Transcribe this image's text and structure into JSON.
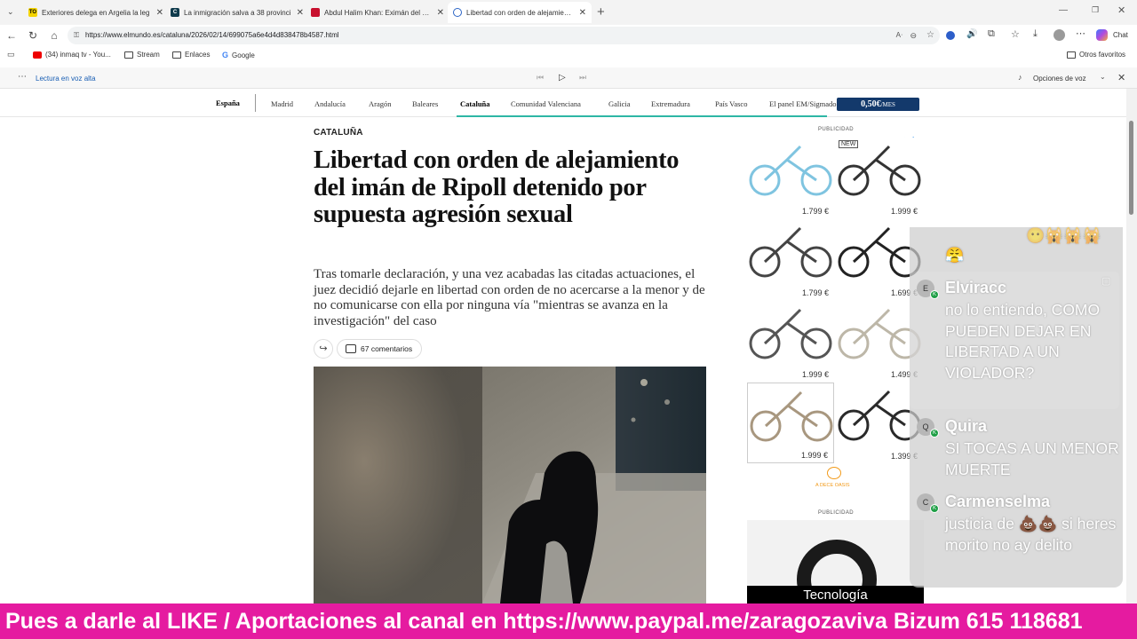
{
  "tabs": [
    {
      "title": "Exteriores delega en Argelia la leg",
      "favicon": "TO",
      "fav_bg": "#f4d400",
      "fav_fg": "#000"
    },
    {
      "title": "La inmigración salva a 38 provinci",
      "favicon": "C",
      "fav_bg": "#0f3b4c",
      "fav_fg": "#fff"
    },
    {
      "title": "Abdul Halim Khan: Eximán del est",
      "favicon": "",
      "fav_bg": "#c8102e",
      "fav_fg": "#fff"
    },
    {
      "title": "Libertad con orden de alejamiento",
      "favicon": "",
      "fav_bg": "#2b64c5",
      "fav_fg": "#fff",
      "active": true
    }
  ],
  "browser": {
    "url": "https://www.elmundo.es/cataluna/2026/02/14/699075a6e4d4d838478b4587.html",
    "chat_label": "Chat"
  },
  "bookmarks": [
    {
      "label": "(34) inmaq tv - You..."
    },
    {
      "label": "Stream"
    },
    {
      "label": "Enlaces"
    },
    {
      "label": "Google"
    }
  ],
  "other_favorites": "Otros favoritos",
  "read_aloud": {
    "label": "Lectura en voz alta",
    "options": "Opciones de voz"
  },
  "section_nav": {
    "items": [
      "España",
      "Madrid",
      "Andalucía",
      "Aragón",
      "Baleares",
      "Cataluña",
      "Comunidad Valenciana",
      "Galicia",
      "Extremadura",
      "País Vasco",
      "El panel EM/Sigmado"
    ],
    "subscribe_price": "0,50€",
    "subscribe_suffix": "/MES"
  },
  "article": {
    "kicker": "CATALUÑA",
    "headline": "Libertad con orden de alejamiento del imán de Ripoll detenido por supuesta agresión sexual",
    "lede": "Tras tomarle declaración, y una vez acabadas las citadas actuaciones, el juez decidió dejarle en libertad con orden de no acercarse a la menor y de no comunicarse con ella por ninguna vía \"mientras se avanza en la investigación\" del caso",
    "comments": "67 comentarios"
  },
  "ads": {
    "label": "PUBLICIDAD",
    "new_badge": "NEW",
    "bikes": [
      {
        "price": "1.799 €",
        "color": "#7fc4e0"
      },
      {
        "price": "1.999 €",
        "color": "#333333"
      },
      {
        "price": "1.799 €",
        "color": "#444444"
      },
      {
        "price": "1.699 €",
        "color": "#222222"
      },
      {
        "price": "1.999 €",
        "color": "#555555"
      },
      {
        "price": "1.499 €",
        "color": "#d8d3c6"
      },
      {
        "price": "1.999 €",
        "color": "#c8b9a4"
      },
      {
        "price": "1.399 €",
        "color": "#2a2a2a"
      }
    ],
    "brand": "A DECE OASIS",
    "label2": "PUBLICIDAD",
    "tech_band": "Tecnología"
  },
  "chat": {
    "messages": [
      {
        "user": "Elviracc",
        "avatar": "E",
        "text": "no lo entiendo, COMO PUEDEN DEJAR EN LIBERTAD A UN VIOLADOR?"
      },
      {
        "user": "Quira",
        "avatar": "Q",
        "text": "SI TOCAS A UN MENOR MUERTE"
      },
      {
        "user": "Carmenselma",
        "avatar": "C",
        "text": "justicia de 💩💩 si heres morito no ay delito"
      }
    ]
  },
  "banner": {
    "text": "Pues a darle al LIKE / Aportaciones al canal en https://www.paypal.me/zaragozaviva Bizum 615 118681"
  },
  "colors": {
    "banner": "#e51ba0",
    "subscribe": "#13396b",
    "accent_line": "#2eb7a5"
  }
}
